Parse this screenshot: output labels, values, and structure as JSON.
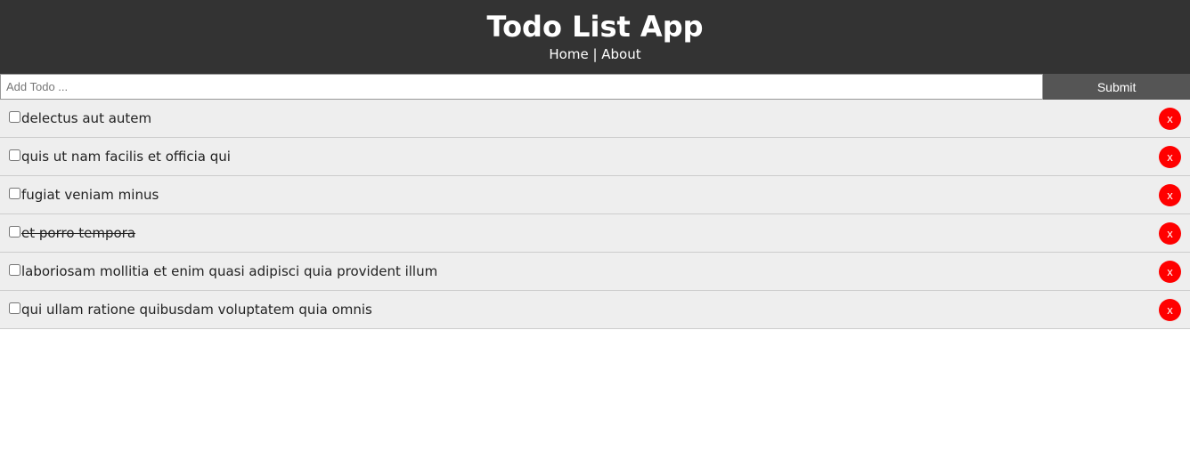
{
  "header": {
    "title": "Todo List App",
    "nav": {
      "home": "Home",
      "separator": " | ",
      "about": "About"
    }
  },
  "add_form": {
    "placeholder": "Add Todo ...",
    "value": "",
    "submit_label": "Submit"
  },
  "todos": [
    {
      "title": "delectus aut autem",
      "completed": false,
      "delete_label": "x"
    },
    {
      "title": "quis ut nam facilis et officia qui",
      "completed": false,
      "delete_label": "x"
    },
    {
      "title": "fugiat veniam minus",
      "completed": false,
      "delete_label": "x"
    },
    {
      "title": "et porro tempora",
      "completed": true,
      "delete_label": "x"
    },
    {
      "title": "laboriosam mollitia et enim quasi adipisci quia provident illum",
      "completed": false,
      "delete_label": "x"
    },
    {
      "title": "qui ullam ratione quibusdam voluptatem quia omnis",
      "completed": false,
      "delete_label": "x"
    }
  ],
  "colors": {
    "header_bg": "#333333",
    "submit_bg": "#555555",
    "item_bg": "#eeeeee",
    "delete_bg": "#ff0000"
  }
}
